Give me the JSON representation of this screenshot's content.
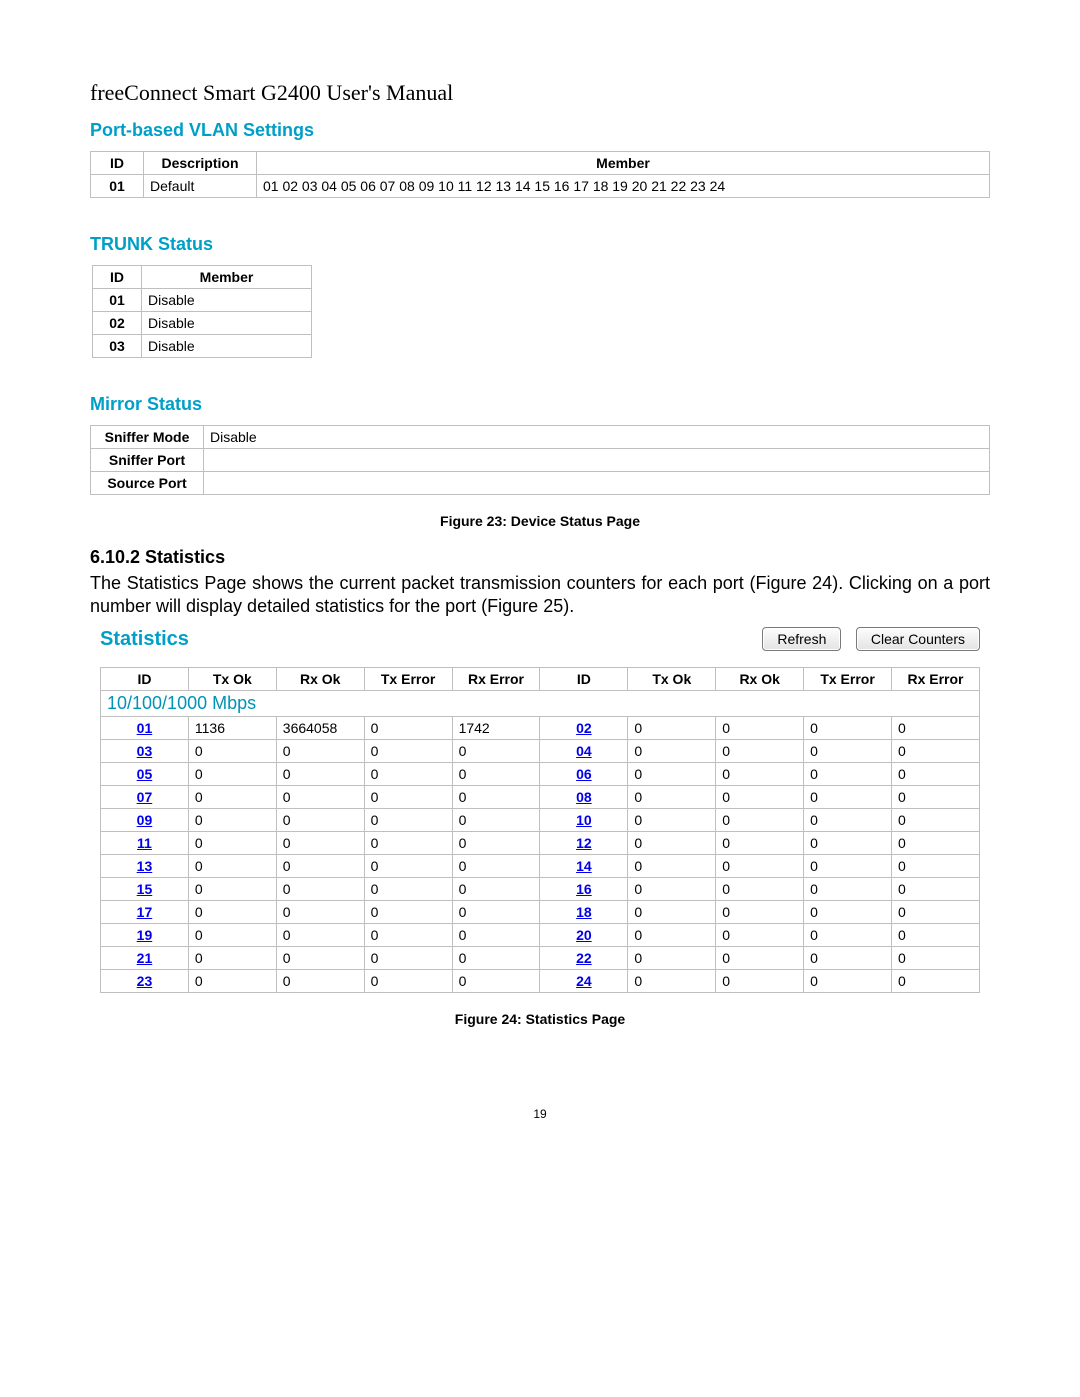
{
  "doc_title": "freeConnect Smart G2400 User's Manual",
  "vlan": {
    "heading": "Port-based VLAN Settings",
    "cols": [
      "ID",
      "Description",
      "Member"
    ],
    "rows": [
      {
        "id": "01",
        "desc": "Default",
        "member": "01 02 03 04 05 06 07 08 09 10 11 12 13 14 15 16 17 18 19 20 21 22 23 24"
      }
    ]
  },
  "trunk": {
    "heading": "TRUNK Status",
    "cols": [
      "ID",
      "Member"
    ],
    "rows": [
      {
        "id": "01",
        "member": "Disable"
      },
      {
        "id": "02",
        "member": "Disable"
      },
      {
        "id": "03",
        "member": "Disable"
      }
    ]
  },
  "mirror": {
    "heading": "Mirror Status",
    "rows": [
      {
        "label": "Sniffer Mode",
        "value": "Disable"
      },
      {
        "label": "Sniffer Port",
        "value": ""
      },
      {
        "label": "Source Port",
        "value": ""
      }
    ]
  },
  "fig23": "Figure 23: Device Status Page",
  "subsection": "6.10.2 Statistics",
  "body": "The Statistics Page shows the current packet transmission counters for each port (Figure 24). Clicking on a port number will display detailed statistics for the port (Figure 25).",
  "stats": {
    "heading": "Statistics",
    "refresh": "Refresh",
    "clear": "Clear Counters",
    "cols": [
      "ID",
      "Tx Ok",
      "Rx Ok",
      "Tx Error",
      "Rx Error",
      "ID",
      "Tx Ok",
      "Rx Ok",
      "Tx Error",
      "Rx Error"
    ],
    "speed_row": "10/100/1000 Mbps",
    "rows": [
      {
        "id1": "01",
        "txok1": "1136",
        "rxok1": "3664058",
        "txerr1": "0",
        "rxerr1": "1742",
        "id2": "02",
        "txok2": "0",
        "rxok2": "0",
        "txerr2": "0",
        "rxerr2": "0"
      },
      {
        "id1": "03",
        "txok1": "0",
        "rxok1": "0",
        "txerr1": "0",
        "rxerr1": "0",
        "id2": "04",
        "txok2": "0",
        "rxok2": "0",
        "txerr2": "0",
        "rxerr2": "0"
      },
      {
        "id1": "05",
        "txok1": "0",
        "rxok1": "0",
        "txerr1": "0",
        "rxerr1": "0",
        "id2": "06",
        "txok2": "0",
        "rxok2": "0",
        "txerr2": "0",
        "rxerr2": "0"
      },
      {
        "id1": "07",
        "txok1": "0",
        "rxok1": "0",
        "txerr1": "0",
        "rxerr1": "0",
        "id2": "08",
        "txok2": "0",
        "rxok2": "0",
        "txerr2": "0",
        "rxerr2": "0"
      },
      {
        "id1": "09",
        "txok1": "0",
        "rxok1": "0",
        "txerr1": "0",
        "rxerr1": "0",
        "id2": "10",
        "txok2": "0",
        "rxok2": "0",
        "txerr2": "0",
        "rxerr2": "0"
      },
      {
        "id1": "11",
        "txok1": "0",
        "rxok1": "0",
        "txerr1": "0",
        "rxerr1": "0",
        "id2": "12",
        "txok2": "0",
        "rxok2": "0",
        "txerr2": "0",
        "rxerr2": "0"
      },
      {
        "id1": "13",
        "txok1": "0",
        "rxok1": "0",
        "txerr1": "0",
        "rxerr1": "0",
        "id2": "14",
        "txok2": "0",
        "rxok2": "0",
        "txerr2": "0",
        "rxerr2": "0"
      },
      {
        "id1": "15",
        "txok1": "0",
        "rxok1": "0",
        "txerr1": "0",
        "rxerr1": "0",
        "id2": "16",
        "txok2": "0",
        "rxok2": "0",
        "txerr2": "0",
        "rxerr2": "0"
      },
      {
        "id1": "17",
        "txok1": "0",
        "rxok1": "0",
        "txerr1": "0",
        "rxerr1": "0",
        "id2": "18",
        "txok2": "0",
        "rxok2": "0",
        "txerr2": "0",
        "rxerr2": "0"
      },
      {
        "id1": "19",
        "txok1": "0",
        "rxok1": "0",
        "txerr1": "0",
        "rxerr1": "0",
        "id2": "20",
        "txok2": "0",
        "rxok2": "0",
        "txerr2": "0",
        "rxerr2": "0"
      },
      {
        "id1": "21",
        "txok1": "0",
        "rxok1": "0",
        "txerr1": "0",
        "rxerr1": "0",
        "id2": "22",
        "txok2": "0",
        "rxok2": "0",
        "txerr2": "0",
        "rxerr2": "0"
      },
      {
        "id1": "23",
        "txok1": "0",
        "rxok1": "0",
        "txerr1": "0",
        "rxerr1": "0",
        "id2": "24",
        "txok2": "0",
        "rxok2": "0",
        "txerr2": "0",
        "rxerr2": "0"
      }
    ]
  },
  "fig24": "Figure 24: Statistics Page",
  "page_num": "19"
}
